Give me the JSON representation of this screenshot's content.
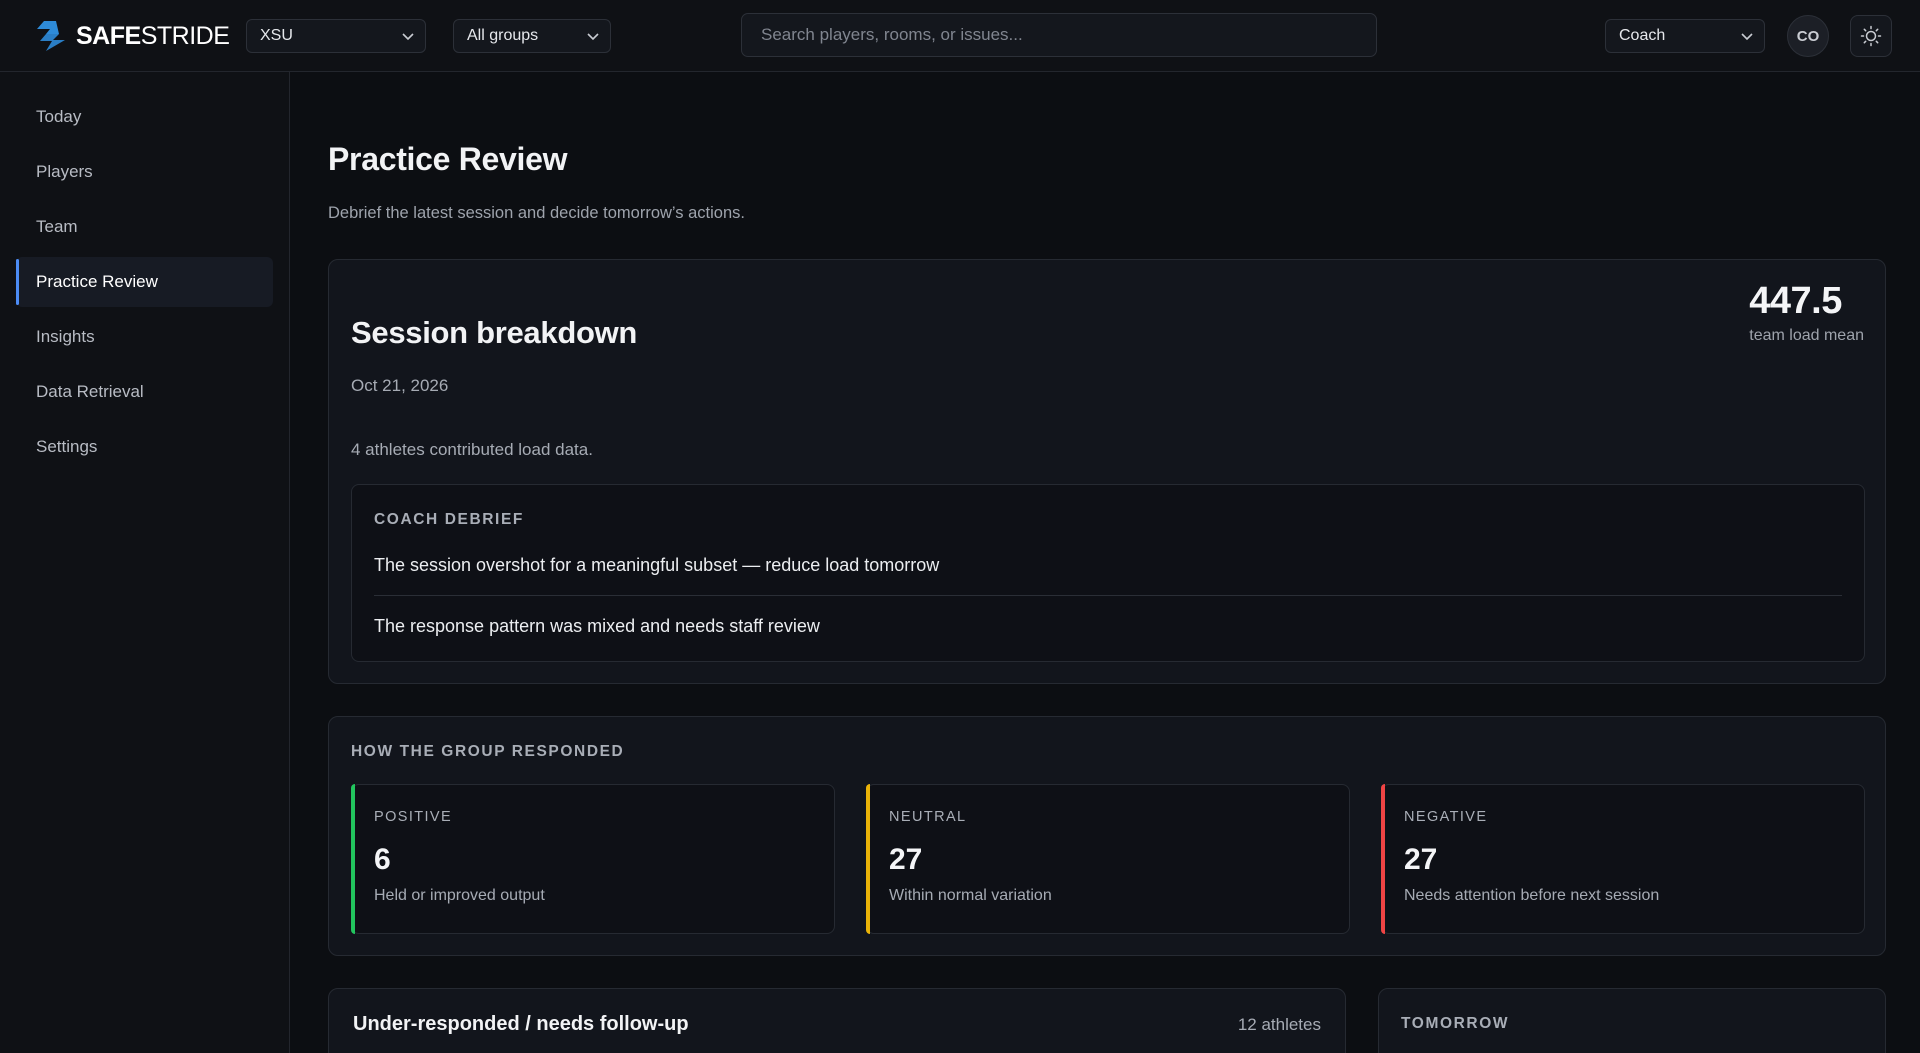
{
  "brand": {
    "name_bold": "SAFE",
    "name_light": "STRIDE",
    "accent": "#2e8bd8"
  },
  "header": {
    "org_select": {
      "value": "XSU"
    },
    "group_select": {
      "value": "All groups"
    },
    "search": {
      "placeholder": "Search players, rooms, or issues..."
    },
    "role_select": {
      "value": "Coach"
    },
    "avatar_initials": "CO",
    "theme_icon": "sun-icon"
  },
  "sidebar": {
    "items": [
      {
        "label": "Today",
        "active": false
      },
      {
        "label": "Players",
        "active": false
      },
      {
        "label": "Team",
        "active": false
      },
      {
        "label": "Practice Review",
        "active": true
      },
      {
        "label": "Insights",
        "active": false
      },
      {
        "label": "Data Retrieval",
        "active": false
      },
      {
        "label": "Settings",
        "active": false
      }
    ]
  },
  "page": {
    "title": "Practice Review",
    "subtitle": "Debrief the latest session and decide tomorrow’s actions."
  },
  "session": {
    "title": "Session breakdown",
    "date": "Oct 21, 2026",
    "note": "4 athletes contributed load data.",
    "stat_value": "447.5",
    "stat_label": "team load mean",
    "debrief": {
      "label": "Coach Debrief",
      "lines": [
        "The session overshot for a meaningful subset — reduce load tomorrow",
        "The response pattern was mixed and needs staff review"
      ]
    }
  },
  "response": {
    "label": "How the group responded",
    "items": [
      {
        "label": "Positive",
        "value": "6",
        "desc": "Held or improved output",
        "color": "#22c55e"
      },
      {
        "label": "Neutral",
        "value": "27",
        "desc": "Within normal variation",
        "color": "#eab308"
      },
      {
        "label": "Negative",
        "value": "27",
        "desc": "Needs attention before next session",
        "color": "#ef4444"
      }
    ]
  },
  "under_responded": {
    "title": "Under-responded / needs follow-up",
    "count": "12 athletes"
  },
  "tomorrow": {
    "label": "Tomorrow"
  }
}
